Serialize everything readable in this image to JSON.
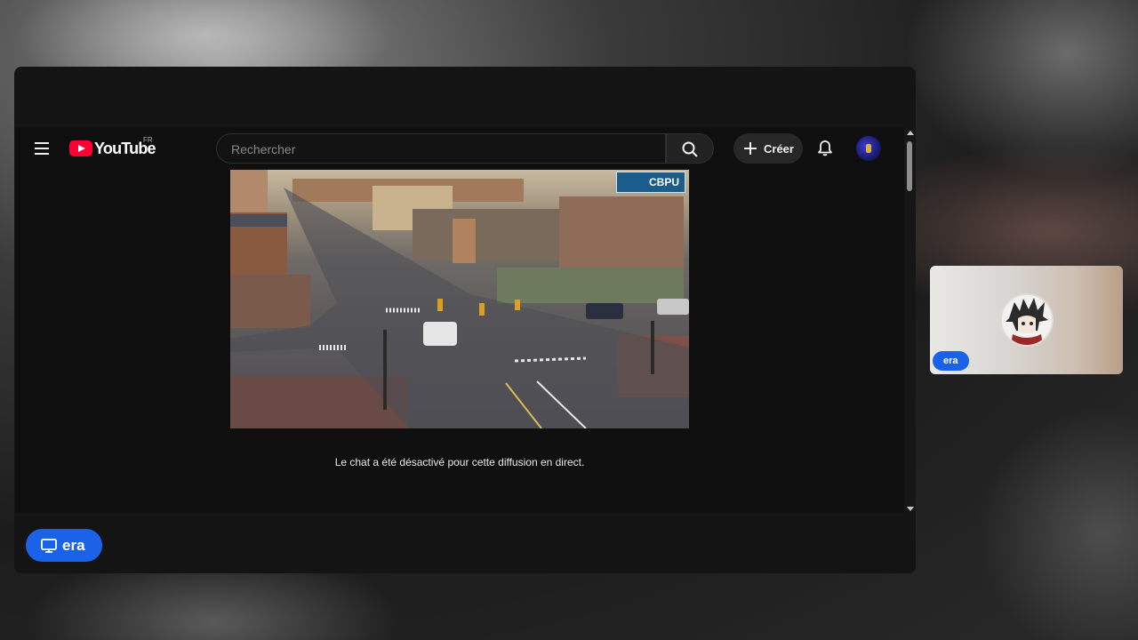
{
  "youtube": {
    "logo_text": "YouTube",
    "country_code": "FR",
    "search_placeholder": "Rechercher",
    "create_label": "Créer"
  },
  "video": {
    "corner_logo_text": "CBPU"
  },
  "chat": {
    "message": "Le chat a été désactivé pour cette diffusion en direct."
  },
  "presenter": {
    "name": "era"
  },
  "participant": {
    "name": "era"
  },
  "colors": {
    "accent": "#1a62e8",
    "youtube_red": "#ff0033",
    "panel": "#141414"
  },
  "icons": [
    "menu-icon",
    "search-icon",
    "plus-icon",
    "bell-icon",
    "present-screen-icon"
  ]
}
